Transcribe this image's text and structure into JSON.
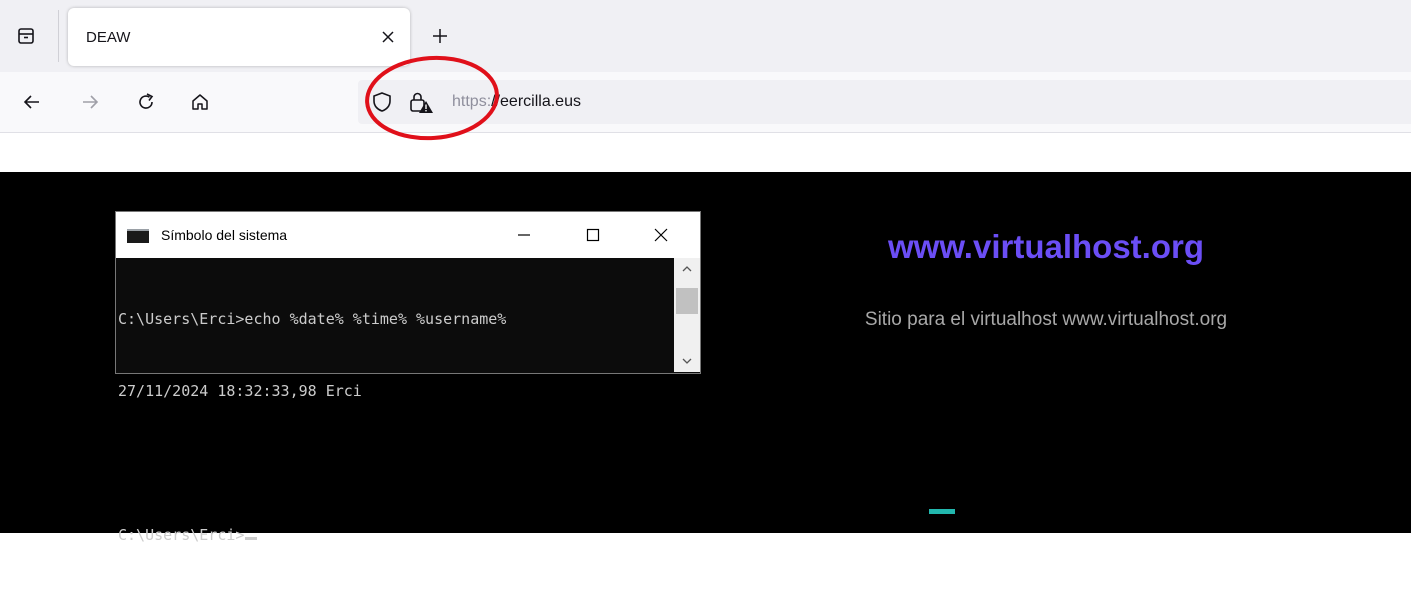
{
  "browser": {
    "tab": {
      "title": "DEAW"
    },
    "address": {
      "scheme": "https:",
      "rest": "//eercilla.eus"
    },
    "icons": {
      "sidebar": "sidebar-icon",
      "tab_close": "close-icon",
      "new_tab": "plus-icon",
      "back": "arrow-left-icon",
      "forward": "arrow-right-icon",
      "reload": "reload-icon",
      "home": "home-icon",
      "tracking_protection": "shield-icon",
      "connection_security": "lock-warning-icon"
    },
    "annotation_color": "#e0101a"
  },
  "cmd_window": {
    "title": "Símbolo del sistema",
    "lines": [
      "C:\\Users\\Erci>echo %date% %time% %username%",
      "27/11/2024 18:32:33,98 Erci",
      "",
      "C:\\Users\\Erci>"
    ]
  },
  "site": {
    "title": "www.virtualhost.org",
    "subtitle": "Sitio para el virtualhost www.virtualhost.org",
    "colors": {
      "title": "#6b4ef6",
      "accent": "#22b7ae",
      "background": "#000000"
    }
  }
}
